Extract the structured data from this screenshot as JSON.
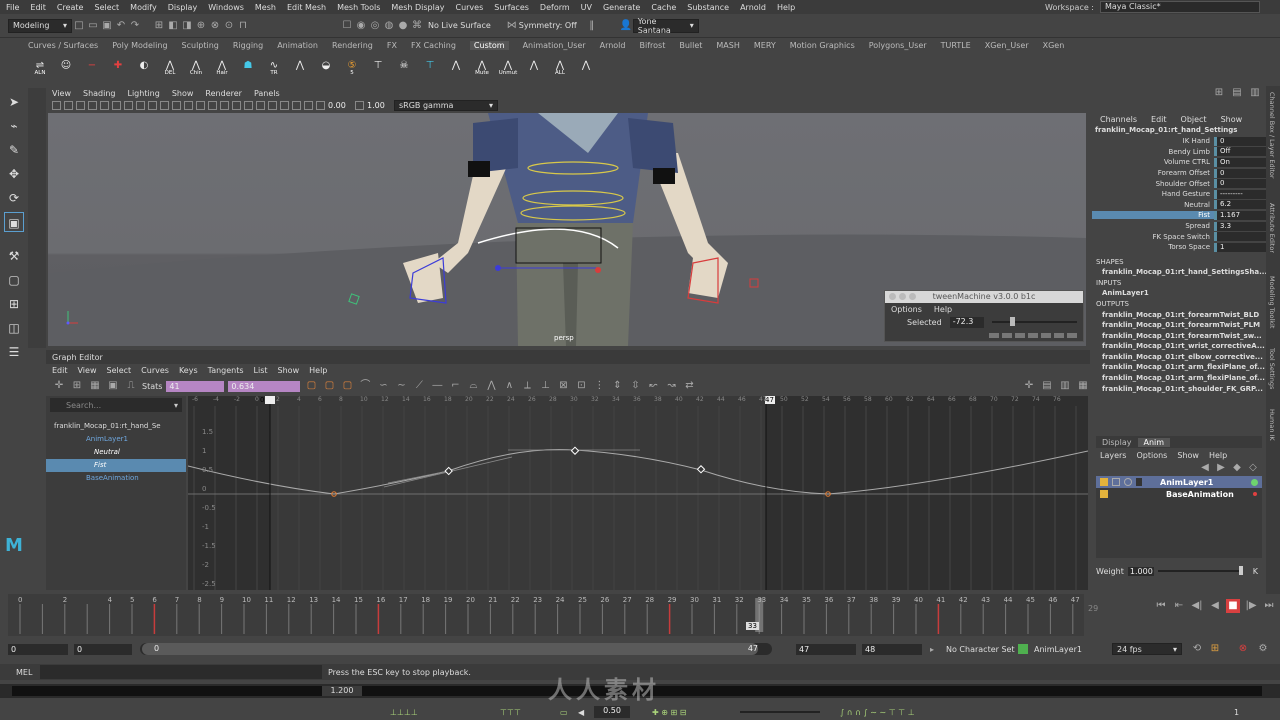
{
  "menubar": [
    "File",
    "Edit",
    "Create",
    "Select",
    "Modify",
    "Display",
    "Windows",
    "Mesh",
    "Edit Mesh",
    "Mesh Tools",
    "Mesh Display",
    "Curves",
    "Surfaces",
    "Deform",
    "UV",
    "Generate",
    "Cache",
    "Substance",
    "Arnold",
    "Help"
  ],
  "workspace": {
    "label": "Workspace :",
    "value": "Maya Classic*"
  },
  "status": {
    "mode": "Modeling",
    "live_surface": "No Live Surface",
    "symmetry": "Symmetry: Off",
    "user": "Yone Santana"
  },
  "shelf_tabs": [
    "Curves / Surfaces",
    "Poly Modeling",
    "Sculpting",
    "Rigging",
    "Animation",
    "Rendering",
    "FX",
    "FX Caching",
    "Custom",
    "Animation_User",
    "Arnold",
    "Bifrost",
    "Bullet",
    "MASH",
    "MERY",
    "Motion Graphics",
    "Polygons_User",
    "TURTLE",
    "XGen_User",
    "XGen"
  ],
  "shelf_active": "Custom",
  "shelf_buttons": [
    {
      "label": "ALN",
      "icon": "align-icon"
    },
    {
      "label": "",
      "icon": "avatar-icon"
    },
    {
      "label": "",
      "icon": "minus-icon"
    },
    {
      "label": "",
      "icon": "plus-icon"
    },
    {
      "label": "",
      "icon": "bunny-icon"
    },
    {
      "label": "DEL",
      "icon": "delete-icon"
    },
    {
      "label": "Chin",
      "icon": "chin-icon"
    },
    {
      "label": "Hair",
      "icon": "hair-icon"
    },
    {
      "label": "",
      "icon": "ghost-icon"
    },
    {
      "label": "TR",
      "icon": "wave-icon"
    },
    {
      "label": "",
      "icon": "m-icon"
    },
    {
      "label": "",
      "icon": "bunny2-icon"
    },
    {
      "label": "5",
      "icon": "five-icon"
    },
    {
      "label": "",
      "icon": "tpose-icon"
    },
    {
      "label": "",
      "icon": "skull-icon"
    },
    {
      "label": "",
      "icon": "tpose-blue-icon"
    },
    {
      "label": "",
      "icon": "m2-icon"
    },
    {
      "label": "Mute",
      "icon": "mute-icon"
    },
    {
      "label": "Unmut",
      "icon": "unmute-icon"
    },
    {
      "label": "",
      "icon": "m3-icon"
    },
    {
      "label": "ALL",
      "icon": "all-icon"
    },
    {
      "label": "",
      "icon": "m4-icon"
    }
  ],
  "viewport": {
    "menu": [
      "View",
      "Shading",
      "Lighting",
      "Show",
      "Renderer",
      "Panels"
    ],
    "exposure": "0.00",
    "gamma": "1.00",
    "colorspace": "sRGB gamma",
    "camera": "persp"
  },
  "tween": {
    "title": "tweenMachine v3.0.0 b1c",
    "menu": [
      "Options",
      "Help"
    ],
    "label": "Selected",
    "value": "-72.3"
  },
  "graph_editor": {
    "title": "Graph Editor",
    "menu": [
      "Edit",
      "View",
      "Select",
      "Curves",
      "Keys",
      "Tangents",
      "List",
      "Show",
      "Help"
    ],
    "stats_label": "Stats",
    "stats_frame": "41",
    "stats_value": "0.634",
    "search_placeholder": "Search...",
    "outliner": [
      "franklin_Mocap_01:rt_hand_Se",
      "AnimLayer1",
      "Neutral",
      "Fist",
      "BaseAnimation"
    ],
    "yticks": [
      "1.5",
      "1",
      "0.5",
      "0",
      "-0.5",
      "-1",
      "-1.5",
      "-2",
      "-2.5"
    ],
    "xticks": [
      "-6",
      "-4",
      "-2",
      "0",
      "2",
      "4",
      "6",
      "8",
      "10",
      "12",
      "14",
      "16",
      "18",
      "20",
      "22",
      "24",
      "26",
      "28",
      "30",
      "32",
      "34",
      "36",
      "38",
      "40",
      "42",
      "44",
      "46",
      "47",
      "50",
      "52",
      "54",
      "56",
      "58",
      "60",
      "62",
      "64",
      "66",
      "68",
      "70",
      "72",
      "74",
      "76"
    ],
    "range_start": "0",
    "range_end": "47"
  },
  "channels": {
    "menu": [
      "Channels",
      "Edit",
      "Object",
      "Show"
    ],
    "node": "franklin_Mocap_01:rt_hand_Settings",
    "attrs": [
      {
        "n": "IK Hand",
        "v": "0"
      },
      {
        "n": "Bendy Limb",
        "v": "Off"
      },
      {
        "n": "Volume CTRL",
        "v": "On"
      },
      {
        "n": "Forearm Offset",
        "v": "0"
      },
      {
        "n": "Shoulder Offset",
        "v": "0"
      },
      {
        "n": "Hand Gesture",
        "v": "---------"
      },
      {
        "n": "Neutral",
        "v": "6.2"
      },
      {
        "n": "Fist",
        "v": "1.167"
      },
      {
        "n": "Spread",
        "v": "3.3"
      },
      {
        "n": "FK Space Switch",
        "v": ""
      },
      {
        "n": "Torso Space",
        "v": "1"
      }
    ],
    "shapes_label": "SHAPES",
    "shape": "franklin_Mocap_01:rt_hand_SettingsSha...",
    "inputs_label": "INPUTS",
    "input": "AnimLayer1",
    "outputs_label": "OUTPUTS",
    "outputs": [
      "franklin_Mocap_01:rt_forearmTwist_BLD",
      "franklin_Mocap_01:rt_forearmTwist_PLM",
      "franklin_Mocap_01:rt_forearmTwist_sw...",
      "franklin_Mocap_01:rt_wrist_correctiveA...",
      "franklin_Mocap_01:rt_elbow_corrective...",
      "franklin_Mocap_01:rt_arm_flexiPlane_of...",
      "franklin_Mocap_01:rt_arm_flexiPlane_of...",
      "franklin_Mocap_01:rt_shoulder_FK_GRP..."
    ]
  },
  "layer_editor": {
    "tabs": [
      "Display",
      "Anim"
    ],
    "menu": [
      "Layers",
      "Options",
      "Show",
      "Help"
    ],
    "layers": [
      "AnimLayer1",
      "BaseAnimation"
    ],
    "weight_label": "Weight",
    "weight": "1.000"
  },
  "side_tabs": [
    "Channel Box / Layer Editor",
    "Attribute Editor",
    "Modeling Toolkit",
    "Tool Settings",
    "Human IK"
  ],
  "timeline": {
    "ticks": [
      "0",
      "2",
      "4",
      "5",
      "6",
      "7",
      "8",
      "9",
      "10",
      "11",
      "12",
      "13",
      "14",
      "15",
      "16",
      "17",
      "18",
      "19",
      "20",
      "21",
      "22",
      "23",
      "24",
      "25",
      "26",
      "27",
      "28",
      "29",
      "30",
      "31",
      "32",
      "33",
      "34",
      "35",
      "36",
      "37",
      "38",
      "39",
      "40",
      "41",
      "42",
      "43",
      "44",
      "45",
      "46",
      "47"
    ],
    "current": "33",
    "end_label": "29"
  },
  "range": {
    "start": "0",
    "start2": "0",
    "slider_start": "0",
    "slider_end": "47",
    "end": "47",
    "end2": "48",
    "charset": "No Character Set",
    "anim_layer": "AnimLayer1",
    "fps": "24 fps"
  },
  "cmd": {
    "label": "MEL",
    "message": "Press the ESC key to stop playback."
  },
  "help": {
    "value": "1.200"
  },
  "bottom": {
    "value": "0.50",
    "right": "1"
  },
  "watermark": "人人素材"
}
